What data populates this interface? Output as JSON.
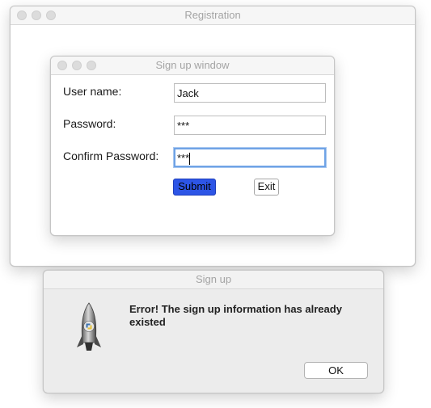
{
  "registration": {
    "title": "Registration"
  },
  "signup": {
    "title": "Sign up window",
    "fields": [
      {
        "label": "User name:",
        "value": "Jack"
      },
      {
        "label": "Password:",
        "value": "***"
      },
      {
        "label": "Confirm Password:",
        "value": "***"
      }
    ],
    "submit_label": "Submit",
    "exit_label": "Exit",
    "submit_color": "#2d55e6"
  },
  "alert": {
    "title": "Sign up",
    "message": "Error! The sign up information has already existed",
    "ok_label": "OK",
    "icon": "python-rocket-icon"
  }
}
